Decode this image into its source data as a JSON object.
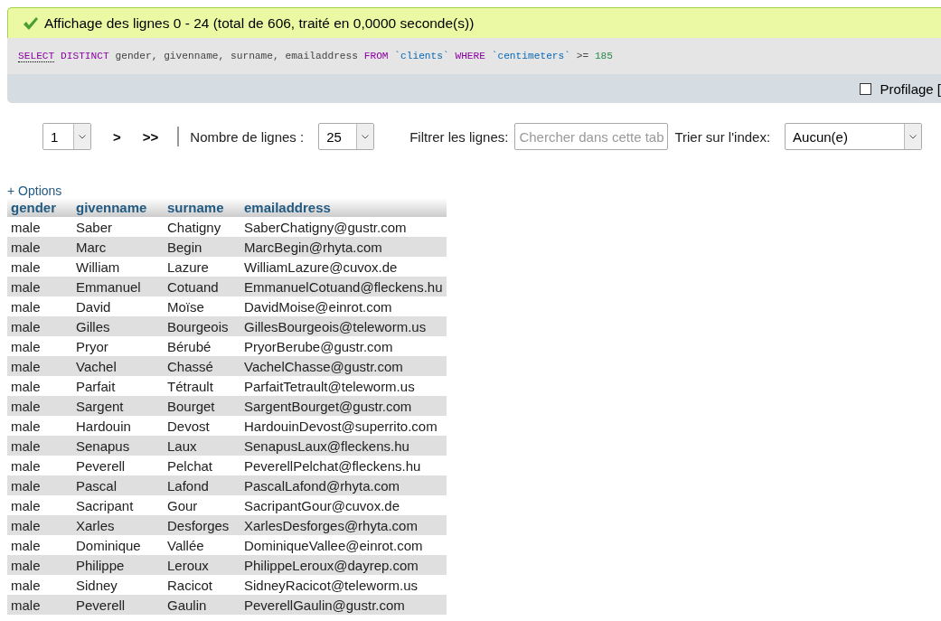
{
  "message": {
    "text": "Affichage des lignes 0 - 24 (total de 606, traité en 0,0000 seconde(s))"
  },
  "sql": [
    {
      "kind": "keyword",
      "text": "SELECT"
    },
    {
      "kind": "keyword",
      "text": " DISTINCT"
    },
    {
      "kind": "plain",
      "text": " gender, givenname, surname, emailaddress "
    },
    {
      "kind": "keyword",
      "text": "FROM"
    },
    {
      "kind": "identifier",
      "text": " `clients`"
    },
    {
      "kind": "keyword",
      "text": " WHERE"
    },
    {
      "kind": "identifier",
      "text": " `centimeters`"
    },
    {
      "kind": "plain",
      "text": " >= "
    },
    {
      "kind": "number",
      "text": "185"
    }
  ],
  "profiling": {
    "label": "Profilage [",
    "checked": false
  },
  "navigation": {
    "page": "1",
    "next": ">",
    "last": ">>",
    "rows_label": "Nombre de lignes :",
    "rows_value": "25",
    "filter_label": "Filtrer les lignes:",
    "filter_placeholder": "Chercher dans cette tab",
    "sort_label": "Trier sur l'index:",
    "sort_value": "Aucun(e)"
  },
  "options_link": "+ Options",
  "table": {
    "columns": [
      "gender",
      "givenname",
      "surname",
      "emailaddress"
    ],
    "rows": [
      [
        "male",
        "Saber",
        "Chatigny",
        "SaberChatigny@gustr.com"
      ],
      [
        "male",
        "Marc",
        "Begin",
        "MarcBegin@rhyta.com"
      ],
      [
        "male",
        "William",
        "Lazure",
        "WilliamLazure@cuvox.de"
      ],
      [
        "male",
        "Emmanuel",
        "Cotuand",
        "EmmanuelCotuand@fleckens.hu"
      ],
      [
        "male",
        "David",
        "Moïse",
        "DavidMoise@einrot.com"
      ],
      [
        "male",
        "Gilles",
        "Bourgeois",
        "GillesBourgeois@teleworm.us"
      ],
      [
        "male",
        "Pryor",
        "Bérubé",
        "PryorBerube@gustr.com"
      ],
      [
        "male",
        "Vachel",
        "Chassé",
        "VachelChasse@gustr.com"
      ],
      [
        "male",
        "Parfait",
        "Tétrault",
        "ParfaitTetrault@teleworm.us"
      ],
      [
        "male",
        "Sargent",
        "Bourget",
        "SargentBourget@gustr.com"
      ],
      [
        "male",
        "Hardouin",
        "Devost",
        "HardouinDevost@superrito.com"
      ],
      [
        "male",
        "Senapus",
        "Laux",
        "SenapusLaux@fleckens.hu"
      ],
      [
        "male",
        "Peverell",
        "Pelchat",
        "PeverellPelchat@fleckens.hu"
      ],
      [
        "male",
        "Pascal",
        "Lafond",
        "PascalLafond@rhyta.com"
      ],
      [
        "male",
        "Sacripant",
        "Gour",
        "SacripantGour@cuvox.de"
      ],
      [
        "male",
        "Xarles",
        "Desforges",
        "XarlesDesforges@rhyta.com"
      ],
      [
        "male",
        "Dominique",
        "Vallée",
        "DominiqueVallee@einrot.com"
      ],
      [
        "male",
        "Philippe",
        "Leroux",
        "PhilippeLeroux@dayrep.com"
      ],
      [
        "male",
        "Sidney",
        "Racicot",
        "SidneyRacicot@teleworm.us"
      ],
      [
        "male",
        "Peverell",
        "Gaulin",
        "PeverellGaulin@gustr.com"
      ]
    ]
  }
}
